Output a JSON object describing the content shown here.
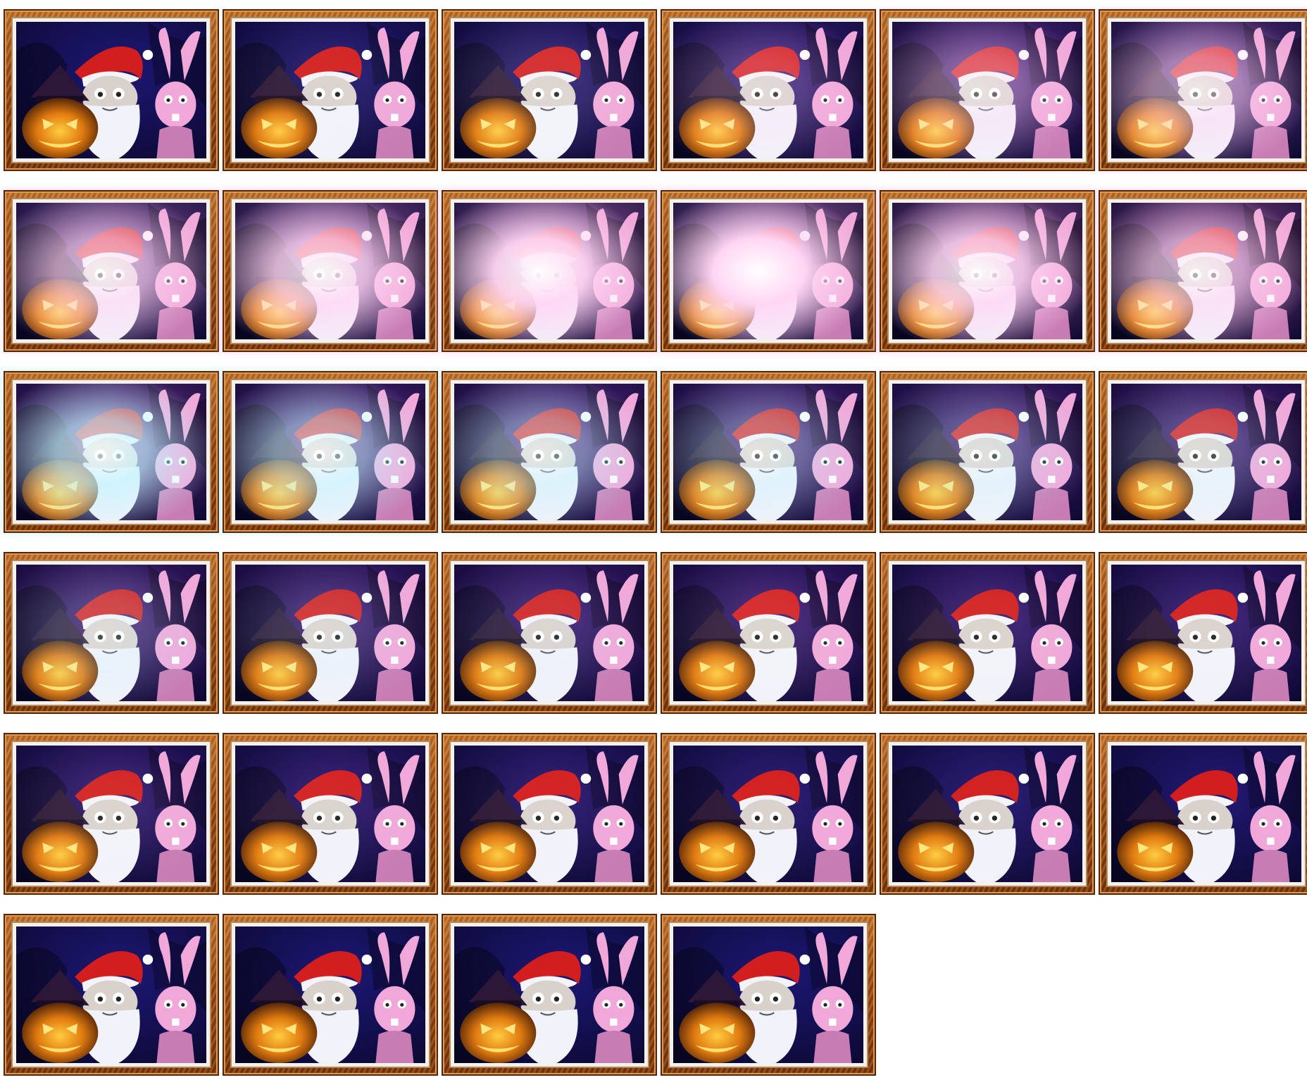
{
  "sprite_sheet": {
    "frame_count": 34,
    "columns": 6,
    "palette": {
      "wood": "#a5531a",
      "bg_blue": "#211a6e",
      "bg_purple": "#6a2a8a",
      "pumpkin": "#e07a10",
      "santa_hat": "#d21e1e",
      "bunny_pink": "#f0a8d8",
      "flash_pink": "#ffd6f4",
      "flash_cyan": "#bff4ff"
    },
    "icons": {
      "pumpkin": "jack-o-lantern-icon",
      "santa": "santa-claus-icon",
      "bunny": "easter-bunny-icon"
    },
    "frames": [
      {
        "flash": 0.0,
        "tint": "blue",
        "bg": "#1e1878"
      },
      {
        "flash": 0.05,
        "tint": "blue",
        "bg": "#221a78"
      },
      {
        "flash": 0.1,
        "tint": "blue",
        "bg": "#2a1a76"
      },
      {
        "flash": 0.2,
        "tint": "pink",
        "bg": "#3a1e80"
      },
      {
        "flash": 0.35,
        "tint": "pink",
        "bg": "#5a2a8a"
      },
      {
        "flash": 0.5,
        "tint": "pink",
        "bg": "#6a3a8e"
      },
      {
        "flash": 0.65,
        "tint": "pink",
        "bg": "#7a4a94"
      },
      {
        "flash": 0.8,
        "tint": "pink",
        "bg": "#8a5098"
      },
      {
        "flash": 0.95,
        "tint": "pink",
        "bg": "#9a5aa0"
      },
      {
        "flash": 1.0,
        "tint": "pink",
        "bg": "#a060a4"
      },
      {
        "flash": 0.85,
        "tint": "pink",
        "bg": "#965296"
      },
      {
        "flash": 0.65,
        "tint": "pink",
        "bg": "#8a4488"
      },
      {
        "flash": 0.7,
        "tint": "cyan",
        "bg": "#6a2e86"
      },
      {
        "flash": 0.55,
        "tint": "cyan",
        "bg": "#5e2884"
      },
      {
        "flash": 0.45,
        "tint": "cyan",
        "bg": "#5a2682"
      },
      {
        "flash": 0.35,
        "tint": "cyan",
        "bg": "#562480"
      },
      {
        "flash": 0.28,
        "tint": "cyan",
        "bg": "#54227e"
      },
      {
        "flash": 0.22,
        "tint": "cyan",
        "bg": "#52207c"
      },
      {
        "flash": 0.2,
        "tint": "cyan",
        "bg": "#4e1e7a"
      },
      {
        "flash": 0.14,
        "tint": "cyan",
        "bg": "#4a1e7a"
      },
      {
        "flash": 0.1,
        "tint": "cyan",
        "bg": "#461c7a"
      },
      {
        "flash": 0.08,
        "tint": "blue",
        "bg": "#421c7a"
      },
      {
        "flash": 0.06,
        "tint": "blue",
        "bg": "#3e1c7a"
      },
      {
        "flash": 0.05,
        "tint": "blue",
        "bg": "#3a1c7a"
      },
      {
        "flash": 0.06,
        "tint": "blue",
        "bg": "#361a78"
      },
      {
        "flash": 0.04,
        "tint": "blue",
        "bg": "#321a78"
      },
      {
        "flash": 0.03,
        "tint": "blue",
        "bg": "#2e1a78"
      },
      {
        "flash": 0.02,
        "tint": "blue",
        "bg": "#2a1a78"
      },
      {
        "flash": 0.02,
        "tint": "blue",
        "bg": "#261a78"
      },
      {
        "flash": 0.0,
        "tint": "blue",
        "bg": "#221a78"
      },
      {
        "flash": 0.0,
        "tint": "blue",
        "bg": "#1e1878"
      },
      {
        "flash": 0.0,
        "tint": "blue",
        "bg": "#1c1878"
      },
      {
        "flash": 0.0,
        "tint": "blue",
        "bg": "#1c1878"
      },
      {
        "flash": 0.0,
        "tint": "blue",
        "bg": "#1c1878"
      }
    ]
  }
}
